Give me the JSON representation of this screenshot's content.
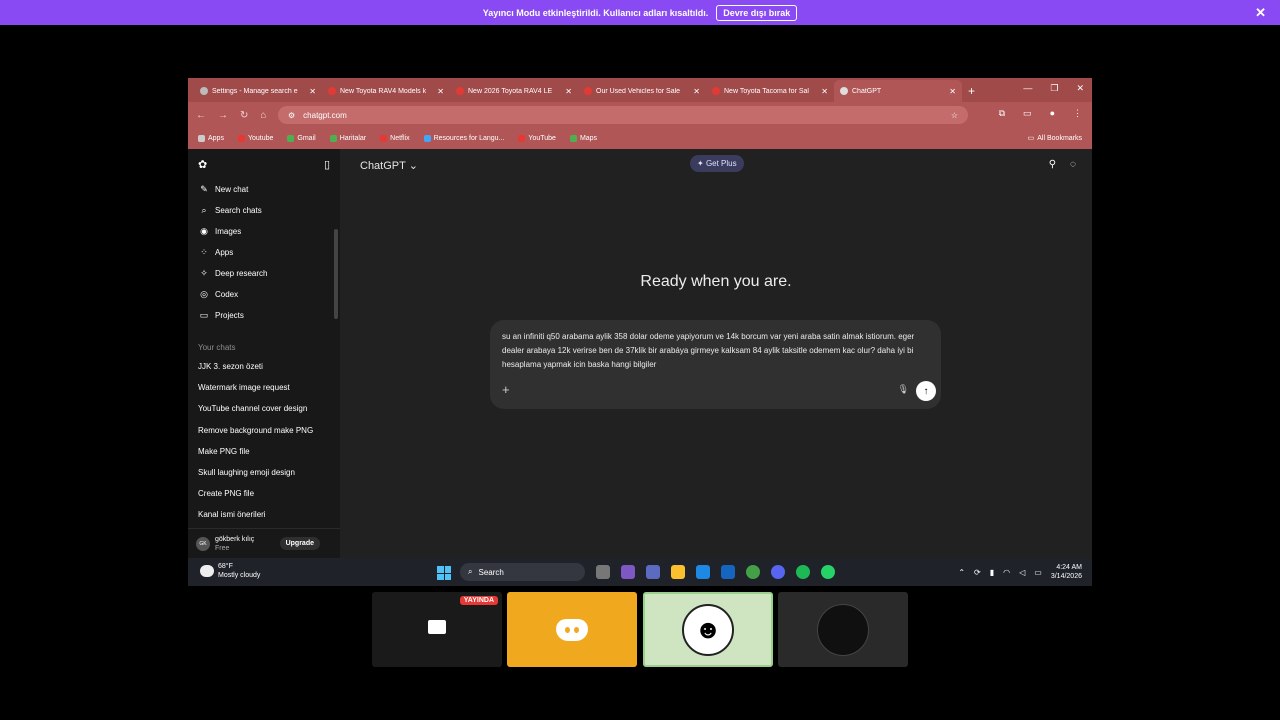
{
  "banner": {
    "text": "Yayıncı Modu etkinleştirildi. Kullanıcı adları kısaltıldı.",
    "button": "Devre dışı bırak",
    "close": "✕"
  },
  "browser": {
    "tabs": [
      {
        "label": "Settings - Manage search e",
        "icon": "gear-icon"
      },
      {
        "label": "New Toyota RAV4 Models k",
        "icon": "toyota-icon"
      },
      {
        "label": "New 2026 Toyota RAV4 LE ",
        "icon": "toyota-icon"
      },
      {
        "label": "Our Used Vehicles for Sale",
        "icon": "toyota-icon"
      },
      {
        "label": "New Toyota Tacoma for Sal",
        "icon": "toyota-icon"
      },
      {
        "label": "ChatGPT",
        "icon": "chatgpt-icon"
      }
    ],
    "url": "chatgpt.com",
    "bookmarks": [
      "Apps",
      "Youtube",
      "Gmail",
      "Haritalar",
      "Netflix",
      "Resources for Langu...",
      "YouTube",
      "Maps"
    ],
    "all_bookmarks": "All Bookmarks"
  },
  "sidebar": {
    "items": [
      {
        "label": "New chat",
        "icon": "edit-icon"
      },
      {
        "label": "Search chats",
        "icon": "search-icon"
      },
      {
        "label": "Images",
        "icon": "image-icon"
      },
      {
        "label": "Apps",
        "icon": "apps-icon"
      },
      {
        "label": "Deep research",
        "icon": "telescope-icon"
      },
      {
        "label": "Codex",
        "icon": "codex-icon"
      },
      {
        "label": "Projects",
        "icon": "folder-icon"
      }
    ],
    "section_label": "Your chats",
    "chats": [
      "JJK 3. sezon özeti",
      "Watermark image request",
      "YouTube channel cover design",
      "Remove background make PNG",
      "Make PNG file",
      "Skull laughing emoji design",
      "Create PNG file",
      "Kanal ismi önerileri"
    ],
    "user": {
      "initials": "GK",
      "name": "gökberk kılıç",
      "plan": "Free",
      "upgrade": "Upgrade"
    }
  },
  "main": {
    "model": "ChatGPT",
    "get_plus": "Get Plus",
    "heading": "Ready when you are.",
    "composer_text": "su an infiniti q50 arabama aylik 358 dolar odeme yapiyorum ve 14k borcum var yeni araba satin almak istiorum. eger dealer arabaya 12k verirse ben de 37klik bir arabáya girmeye kalksam 84 aylik taksitle odemem kac olur? daha iyi bi hesaplama yapmak icin baska hangi bilgiler"
  },
  "taskbar": {
    "weather_temp": "68°F",
    "weather_desc": "Mostly cloudy",
    "search": "Search",
    "time": "4:24 AM",
    "date": "3/14/2026"
  },
  "thumbnails": {
    "live_badge": "YAYINDA"
  }
}
